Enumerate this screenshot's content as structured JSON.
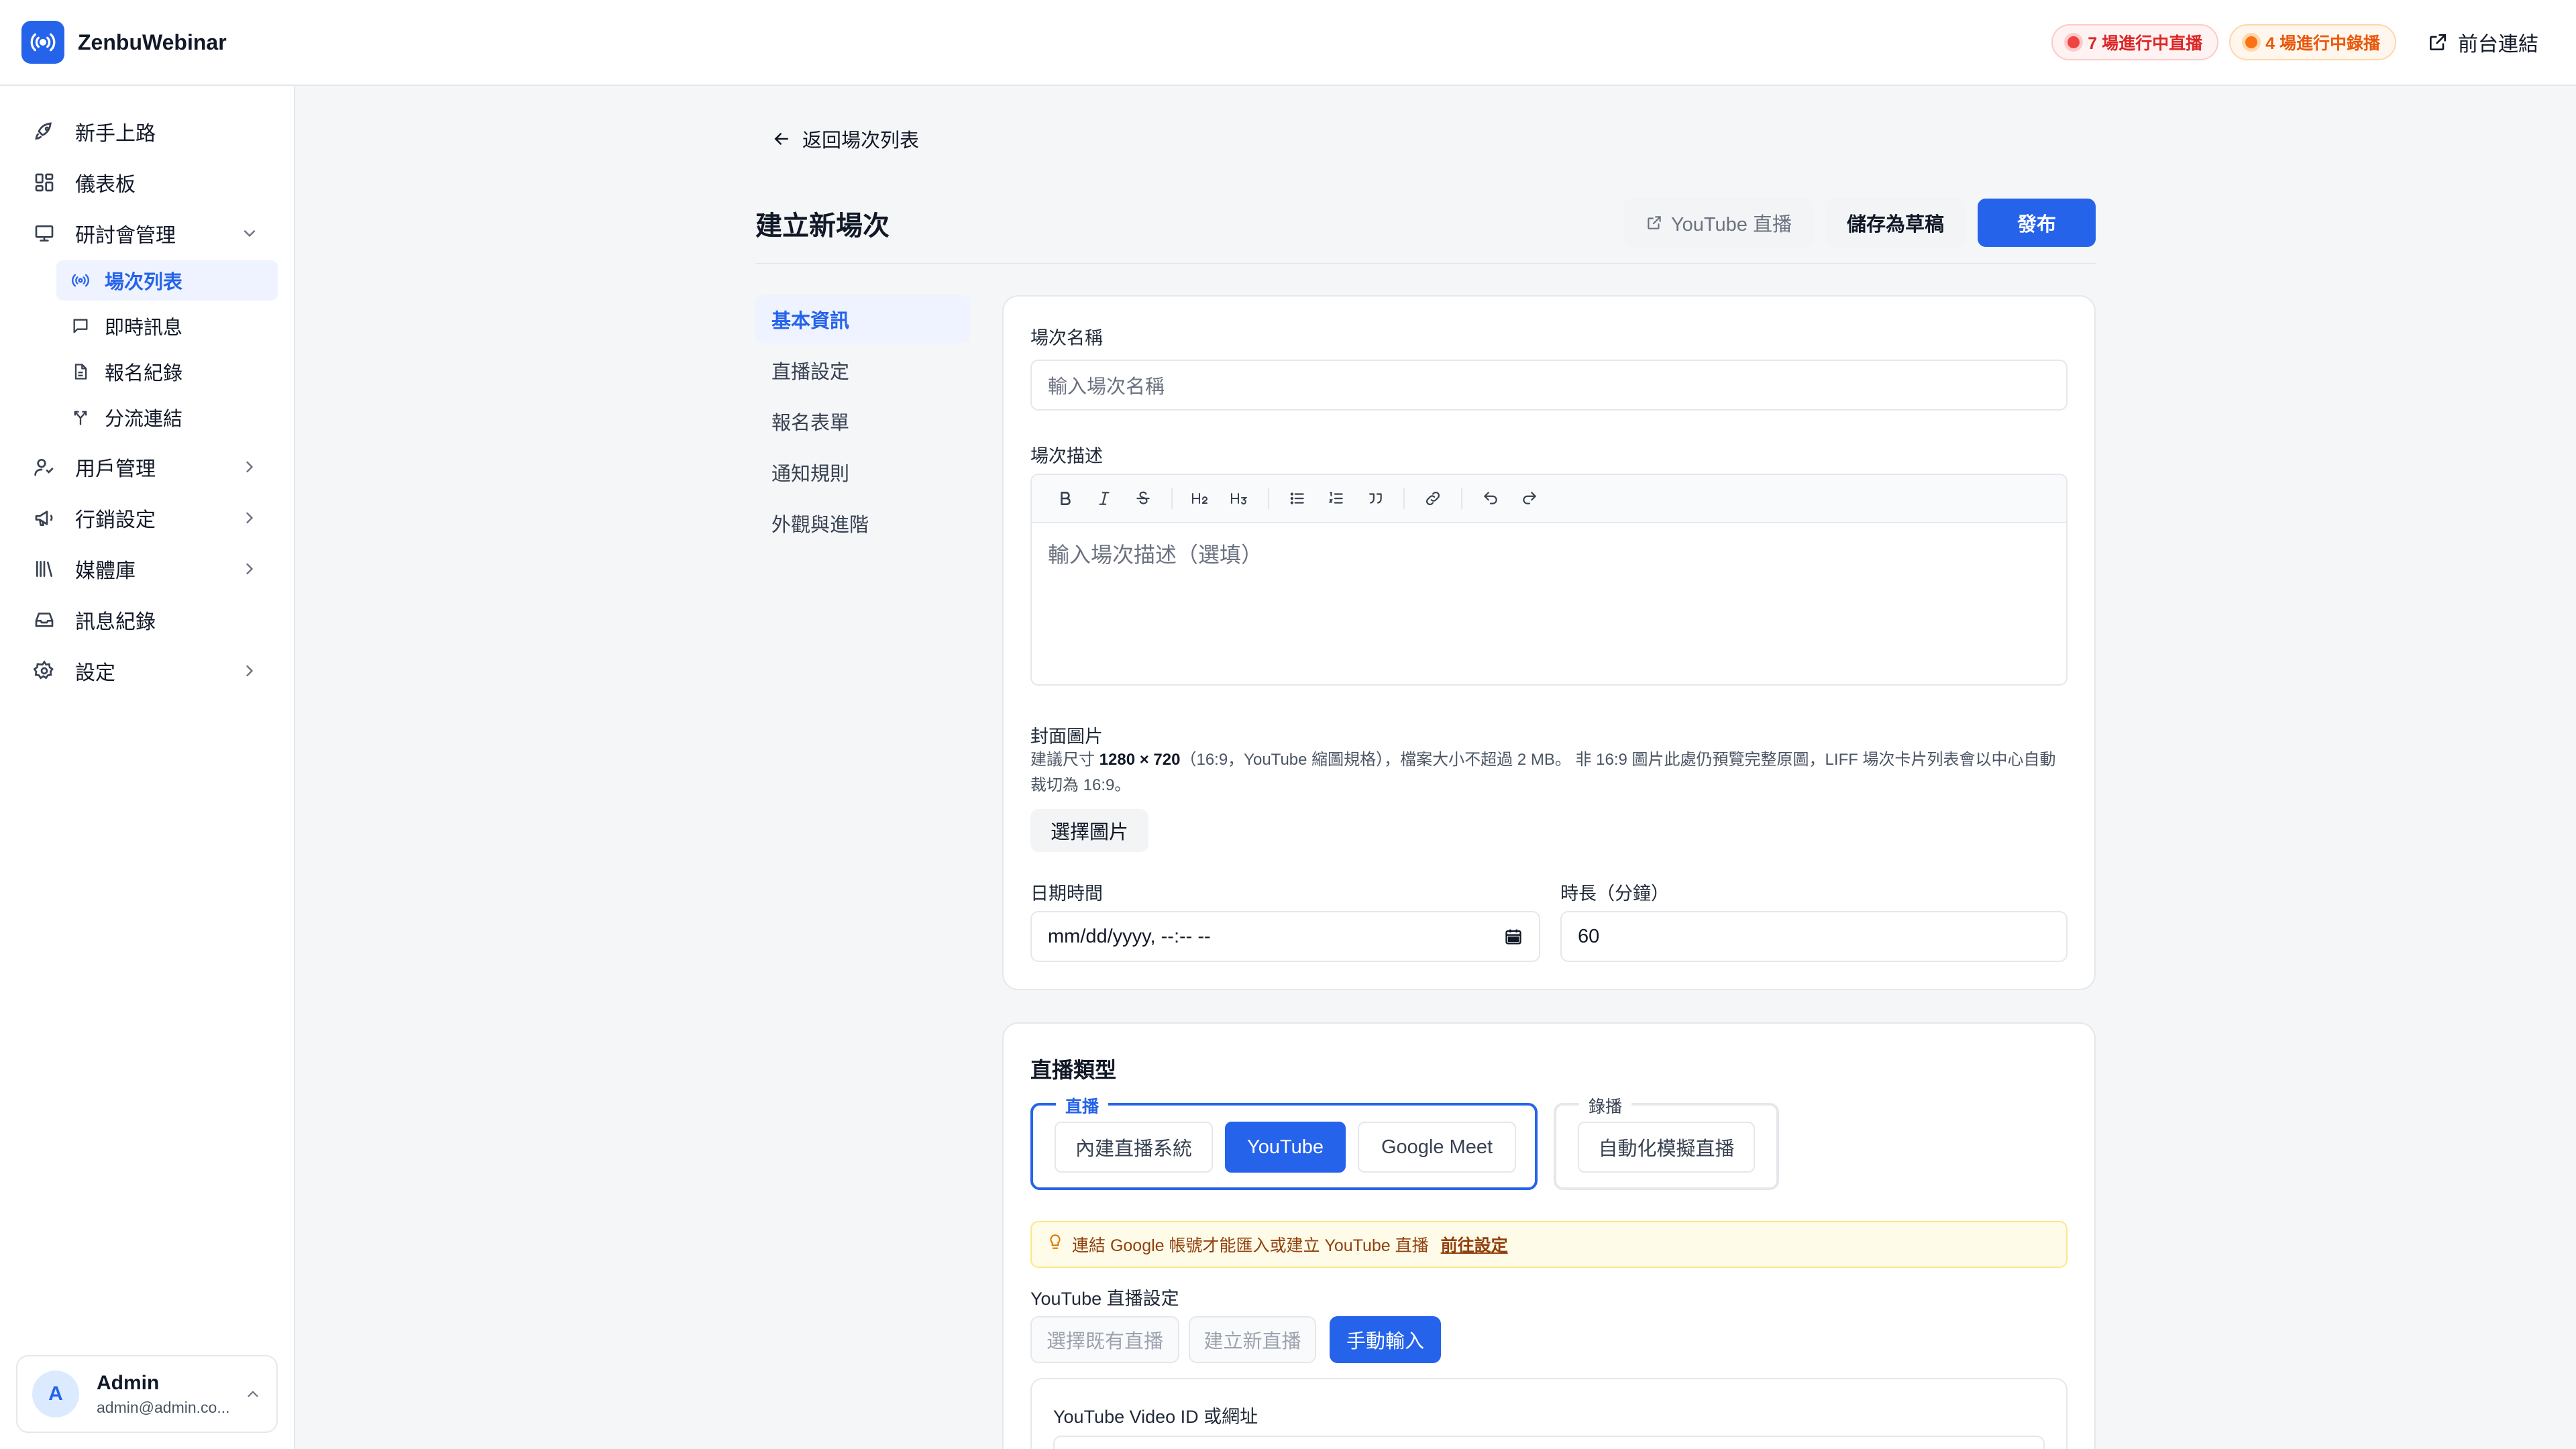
{
  "app": {
    "name": "ZenbuWebinar"
  },
  "topbar": {
    "live_badge": "7 場進行中直播",
    "rec_badge": "4 場進行中錄播",
    "front_link": "前台連結"
  },
  "sidebar": {
    "items": [
      {
        "label": "新手上路",
        "icon": "rocket-icon"
      },
      {
        "label": "儀表板",
        "icon": "dashboard-icon"
      },
      {
        "label": "研討會管理",
        "icon": "presentation-icon"
      },
      {
        "label": "用戶管理",
        "icon": "users-icon"
      },
      {
        "label": "行銷設定",
        "icon": "megaphone-icon"
      },
      {
        "label": "媒體庫",
        "icon": "library-icon"
      },
      {
        "label": "訊息紀錄",
        "icon": "inbox-icon"
      },
      {
        "label": "設定",
        "icon": "gear-icon"
      }
    ],
    "sub_items": [
      {
        "label": "場次列表",
        "icon": "broadcast-icon",
        "active": true
      },
      {
        "label": "即時訊息",
        "icon": "chat-icon"
      },
      {
        "label": "報名紀錄",
        "icon": "file-icon"
      },
      {
        "label": "分流連結",
        "icon": "split-icon"
      }
    ],
    "user": {
      "initial": "A",
      "name": "Admin",
      "email": "admin@admin.co..."
    }
  },
  "main": {
    "back_label": "返回場次列表",
    "title": "建立新場次",
    "actions": {
      "youtube": "YouTube 直播",
      "draft": "儲存為草稿",
      "publish": "發布"
    },
    "sections": [
      "基本資訊",
      "直播設定",
      "報名表單",
      "通知規則",
      "外觀與進階"
    ],
    "basic": {
      "name_label": "場次名稱",
      "name_placeholder": "輸入場次名稱",
      "desc_label": "場次描述",
      "desc_placeholder": "輸入場次描述（選填）",
      "cover_label": "封面圖片",
      "cover_hint_pre": "建議尺寸 ",
      "cover_hint_size": "1280 × 720",
      "cover_hint_post": "（16:9，YouTube 縮圖規格），檔案大小不超過 2 MB。 非 16:9 圖片此處仍預覽完整原圖，LIFF 場次卡片列表會以中心自動裁切為 16:9。",
      "choose_image": "選擇圖片",
      "datetime_label": "日期時間",
      "datetime_value": "mm/dd/yyyy, --:-- --",
      "duration_label": "時長（分鐘）",
      "duration_value": "60"
    },
    "live": {
      "title": "直播類型",
      "group_live": "直播",
      "group_rec": "錄播",
      "live_options": [
        "內建直播系統",
        "YouTube",
        "Google Meet"
      ],
      "rec_options": [
        "自動化模擬直播"
      ],
      "selected": "YouTube",
      "notice": "連結 Google 帳號才能匯入或建立 YouTube 直播",
      "notice_link": "前往設定",
      "yt_settings_label": "YouTube 直播設定",
      "yt_modes": [
        "選擇既有直播",
        "建立新直播",
        "手動輸入"
      ],
      "yt_mode_selected": "手動輸入",
      "video_id_label": "YouTube Video ID 或網址"
    }
  },
  "colors": {
    "accent": "#2563eb",
    "live": "#dc2626",
    "rec": "#ea580c"
  }
}
